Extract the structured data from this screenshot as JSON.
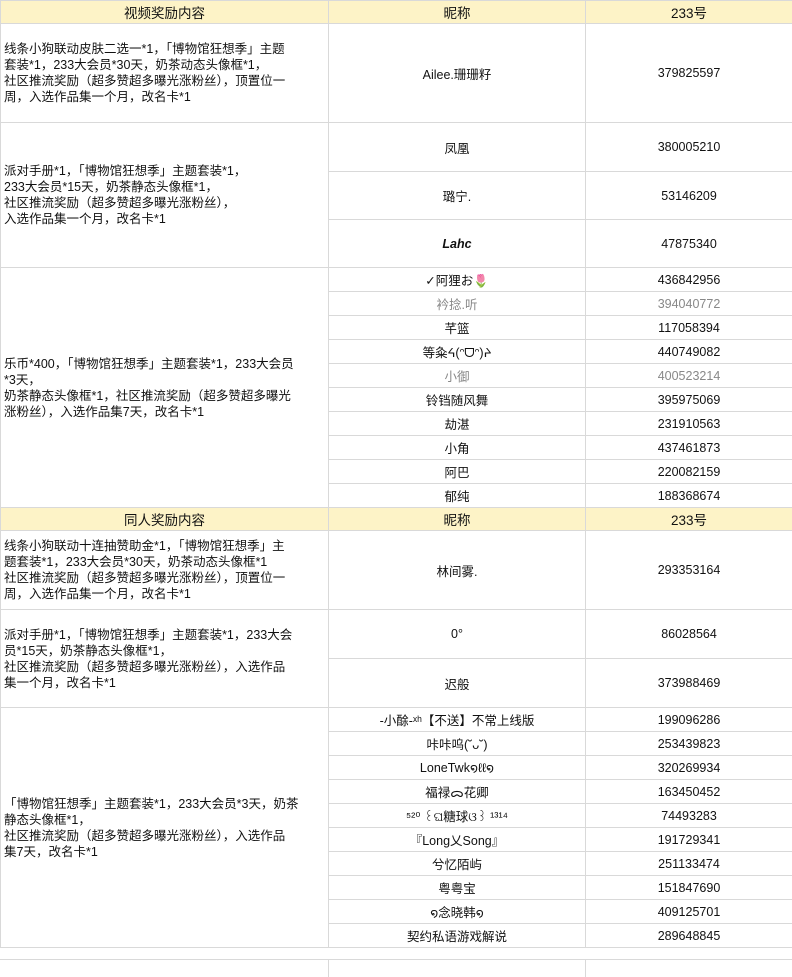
{
  "section1": {
    "headers": [
      "视频奖励内容",
      "昵称",
      "233号"
    ],
    "groups": [
      {
        "reward_lines": [
          "线条小狗联动皮肤二选一*1，「博物馆狂想季」主题",
          "套装*1，233大会员*30天，奶茶动态头像框*1，",
          "社区推流奖励（超多赞超多曝光涨粉丝），顶置位一",
          "周，入选作品集一个月，改名卡*1"
        ],
        "rows": [
          {
            "nick": "Ailee.珊珊籽",
            "uid": "379825597"
          }
        ]
      },
      {
        "reward_lines": [
          "派对手册*1，「博物馆狂想季」主题套装*1，",
          "233大会员*15天，奶茶静态头像框*1，",
          "社区推流奖励（超多赞超多曝光涨粉丝），",
          "入选作品集一个月，改名卡*1"
        ],
        "rows": [
          {
            "nick": "凤凰",
            "uid": "380005210"
          },
          {
            "nick": "璐宁.",
            "uid": "53146209"
          },
          {
            "nick": "Lahc",
            "uid": "47875340"
          }
        ]
      },
      {
        "reward_lines": [
          "乐币*400，「博物馆狂想季」主题套装*1，233大会员",
          "*3天，",
          "奶茶静态头像框*1，社区推流奖励（超多赞超多曝光",
          "涨粉丝），入选作品集7天，改名卡*1"
        ],
        "rows": [
          {
            "nick": "✓阿狸お🌷",
            "uid": "436842956"
          },
          {
            "nick": "衿捻.听",
            "uid": "394040772"
          },
          {
            "nick": "芊篮",
            "uid": "117058394"
          },
          {
            "nick": "等粂ᔦ(ᵔᗜᵔ)ᔨ",
            "uid": "440749082"
          },
          {
            "nick": "小御",
            "uid": "400523214"
          },
          {
            "nick": "铃铛随风舞",
            "uid": "395975069"
          },
          {
            "nick": "劫湛",
            "uid": "231910563"
          },
          {
            "nick": "小角",
            "uid": "437461873"
          },
          {
            "nick": "阿巴",
            "uid": "220082159"
          },
          {
            "nick": "郁纯",
            "uid": "188368674"
          }
        ]
      }
    ]
  },
  "section2": {
    "headers": [
      "同人奖励内容",
      "昵称",
      "233号"
    ],
    "groups": [
      {
        "reward_lines": [
          "线条小狗联动十连抽赞助金*1，「博物馆狂想季」主",
          "题套装*1，233大会员*30天，奶茶动态头像框*1",
          "社区推流奖励（超多赞超多曝光涨粉丝），顶置位一",
          "周，入选作品集一个月，改名卡*1"
        ],
        "rows": [
          {
            "nick": "林间雾.",
            "uid": "293353164"
          }
        ]
      },
      {
        "reward_lines": [
          "派对手册*1，「博物馆狂想季」主题套装*1，233大会",
          "员*15天，奶茶静态头像框*1，",
          "社区推流奖励（超多赞超多曝光涨粉丝），入选作品",
          "集一个月，改名卡*1"
        ],
        "rows": [
          {
            "nick": "0°",
            "uid": "86028564"
          },
          {
            "nick": "迟般",
            "uid": "373988469"
          }
        ]
      },
      {
        "reward_lines": [
          "「博物馆狂想季」主题套装*1，233大会员*3天，奶茶",
          "静态头像框*1，",
          "社区推流奖励（超多赞超多曝光涨粉丝），入选作品",
          "集7天，改名卡*1"
        ],
        "rows": [
          {
            "nick": "-小酴-ˣʰ【不送】不常上线版",
            "uid": "199096286"
          },
          {
            "nick": "咔咔呜(˘ᴗ˘)",
            "uid": "253439823"
          },
          {
            "nick": "LoneTwk໑ℓℓ໑",
            "uid": "320269934"
          },
          {
            "nick": "福禄ᯅ花卿",
            "uid": "163450452"
          },
          {
            "nick": "⁵²⁰ ꒰ଘ糖球ଓ꒱ ¹³¹⁴",
            "uid": "74493283"
          },
          {
            "nick": "『Long乂Song』",
            "uid": "191729341"
          },
          {
            "nick": "兮忆陌屿",
            "uid": "251133474"
          },
          {
            "nick": "粤粤宝",
            "uid": "151847690"
          },
          {
            "nick": "໑念晓韩໑",
            "uid": "409125701"
          },
          {
            "nick": "契约私语游戏解说",
            "uid": "289648845"
          }
        ]
      }
    ]
  }
}
